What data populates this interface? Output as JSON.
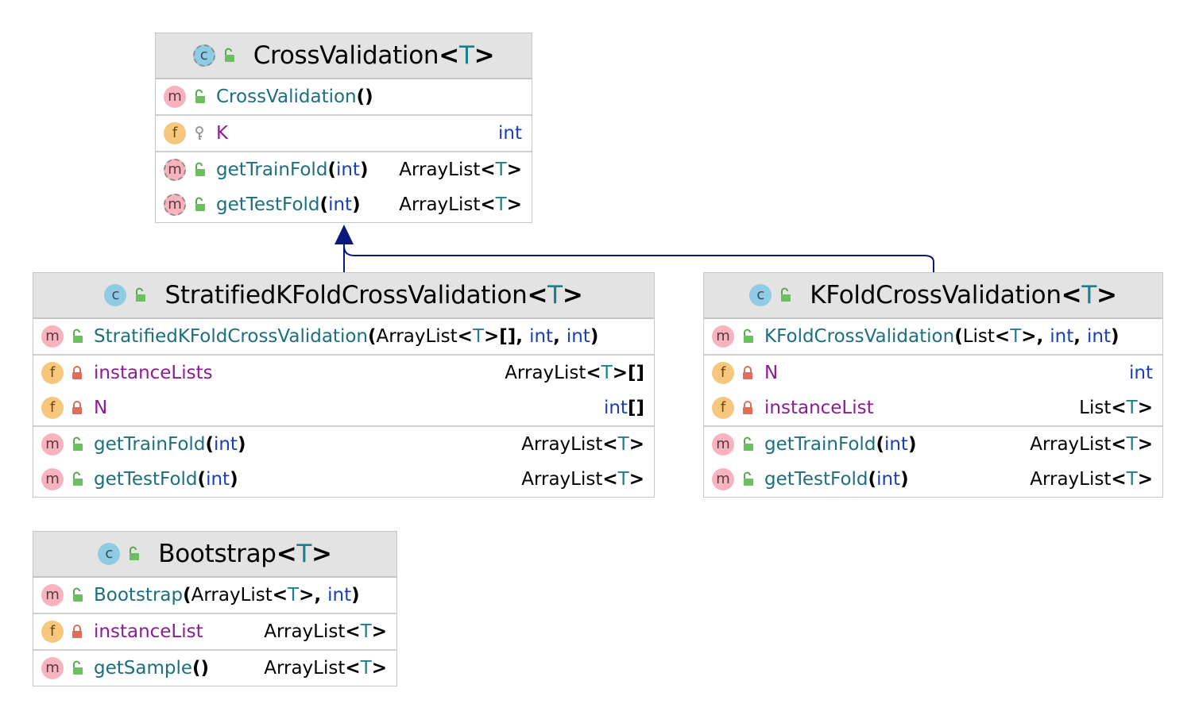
{
  "diagram": {
    "classes": [
      {
        "id": "crossvalidation",
        "name": "CrossValidation",
        "generic": "T",
        "kind_icon": "abstract-class-icon",
        "members": [
          [
            {
              "badge": "m",
              "name": "CrossValidation",
              "signature": "()",
              "type": ""
            }
          ],
          [
            {
              "badge": "f",
              "name": "K",
              "signature": "",
              "type": "int",
              "visibility": "package"
            }
          ],
          [
            {
              "badge": "m",
              "abstract": true,
              "name": "getTrainFold",
              "signature": "(int)",
              "type": "ArrayList<T>"
            },
            {
              "badge": "m",
              "abstract": true,
              "name": "getTestFold",
              "signature": "(int)",
              "type": "ArrayList<T>"
            }
          ]
        ]
      },
      {
        "id": "stratified",
        "name": "StratifiedKFoldCrossValidation",
        "generic": "T",
        "kind_icon": "class-icon",
        "members": [
          [
            {
              "badge": "m",
              "name": "StratifiedKFoldCrossValidation",
              "signature": "(ArrayList<T>[], int, int)",
              "type": ""
            }
          ],
          [
            {
              "badge": "f",
              "name": "instanceLists",
              "signature": "",
              "type": "ArrayList<T>[]",
              "visibility": "private"
            },
            {
              "badge": "f",
              "name": "N",
              "signature": "",
              "type": "int[]",
              "visibility": "private"
            }
          ],
          [
            {
              "badge": "m",
              "name": "getTrainFold",
              "signature": "(int)",
              "type": "ArrayList<T>"
            },
            {
              "badge": "m",
              "name": "getTestFold",
              "signature": "(int)",
              "type": "ArrayList<T>"
            }
          ]
        ]
      },
      {
        "id": "kfold",
        "name": "KFoldCrossValidation",
        "generic": "T",
        "kind_icon": "class-icon",
        "members": [
          [
            {
              "badge": "m",
              "name": "KFoldCrossValidation",
              "signature": "(List<T>, int, int)",
              "type": ""
            }
          ],
          [
            {
              "badge": "f",
              "name": "N",
              "signature": "",
              "type": "int",
              "visibility": "private"
            },
            {
              "badge": "f",
              "name": "instanceList",
              "signature": "",
              "type": "List<T>",
              "visibility": "private"
            }
          ],
          [
            {
              "badge": "m",
              "name": "getTrainFold",
              "signature": "(int)",
              "type": "ArrayList<T>"
            },
            {
              "badge": "m",
              "name": "getTestFold",
              "signature": "(int)",
              "type": "ArrayList<T>"
            }
          ]
        ]
      },
      {
        "id": "bootstrap",
        "name": "Bootstrap",
        "generic": "T",
        "kind_icon": "class-icon",
        "members": [
          [
            {
              "badge": "m",
              "name": "Bootstrap",
              "signature": "(ArrayList<T>, int)",
              "type": ""
            }
          ],
          [
            {
              "badge": "f",
              "name": "instanceList",
              "signature": "",
              "type": "ArrayList<T>",
              "visibility": "private"
            }
          ],
          [
            {
              "badge": "m",
              "name": "getSample",
              "signature": "()",
              "type": "ArrayList<T>"
            }
          ]
        ]
      }
    ],
    "edges": [
      {
        "from": "stratified",
        "to": "crossvalidation",
        "kind": "extends"
      },
      {
        "from": "kfold",
        "to": "crossvalidation",
        "kind": "extends"
      }
    ],
    "colors": {
      "method_name": "#1b6f7f",
      "field_name": "#8b1c94",
      "keyword": "#1a3eb6",
      "type_param": "#1b7f8e",
      "edge": "#0a1a7a",
      "header_bg": "#e3e3e3"
    }
  }
}
